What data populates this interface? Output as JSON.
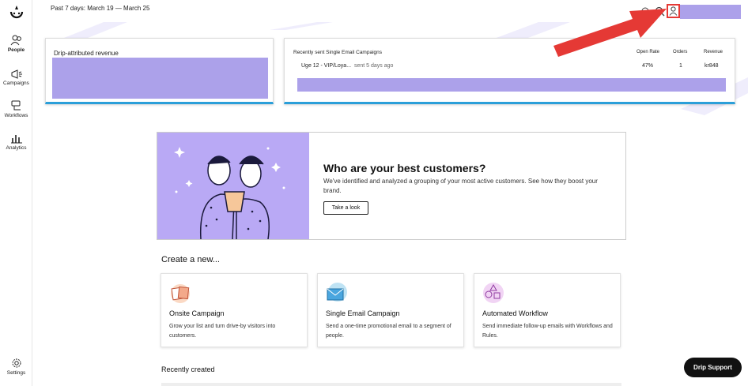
{
  "sidebar": {
    "logo_icon": "drip-logo-icon",
    "items": [
      {
        "label": "People",
        "icon": "people-icon"
      },
      {
        "label": "Campaigns",
        "icon": "megaphone-icon"
      },
      {
        "label": "Workflows",
        "icon": "workflow-icon"
      },
      {
        "label": "Analytics",
        "icon": "analytics-icon"
      }
    ],
    "settings": {
      "label": "Settings",
      "icon": "gear-icon"
    }
  },
  "header": {
    "date_range": "Past 7 days: March 19 — March 25",
    "icons": [
      "bell-icon",
      "search-icon",
      "user-icon"
    ]
  },
  "revenue_card": {
    "title": "Drip-attributed revenue"
  },
  "campaigns_card": {
    "title": "Recently sent Single Email Campaigns",
    "columns": [
      "Open Rate",
      "Orders",
      "Revenue"
    ],
    "rows": [
      {
        "name": "Uge 12 - VIP/Loya...",
        "sent": "sent 5 days ago",
        "open_rate": "47%",
        "orders": "1",
        "revenue": "kr848"
      }
    ]
  },
  "promo": {
    "heading": "Who are your best customers?",
    "body": "We've identified and analyzed a grouping of your most active customers. See how they boost your brand.",
    "button": "Take a look"
  },
  "create": {
    "heading": "Create a new...",
    "tiles": [
      {
        "title": "Onsite Campaign",
        "desc": "Grow your list and turn drive-by visitors into customers.",
        "icon": "onsite-campaign-icon"
      },
      {
        "title": "Single Email Campaign",
        "desc": "Send a one-time promotional email to a segment of people.",
        "icon": "envelope-icon"
      },
      {
        "title": "Automated Workflow",
        "desc": "Send immediate follow-up emails with Workflows and Rules.",
        "icon": "workflow-shapes-icon"
      }
    ]
  },
  "recently_created": {
    "heading": "Recently created"
  },
  "support_button": "Drip Support",
  "colors": {
    "accent_purple": "#aca1ea",
    "card_border_blue": "#2b9fd9",
    "arrow_red": "#e53935"
  }
}
